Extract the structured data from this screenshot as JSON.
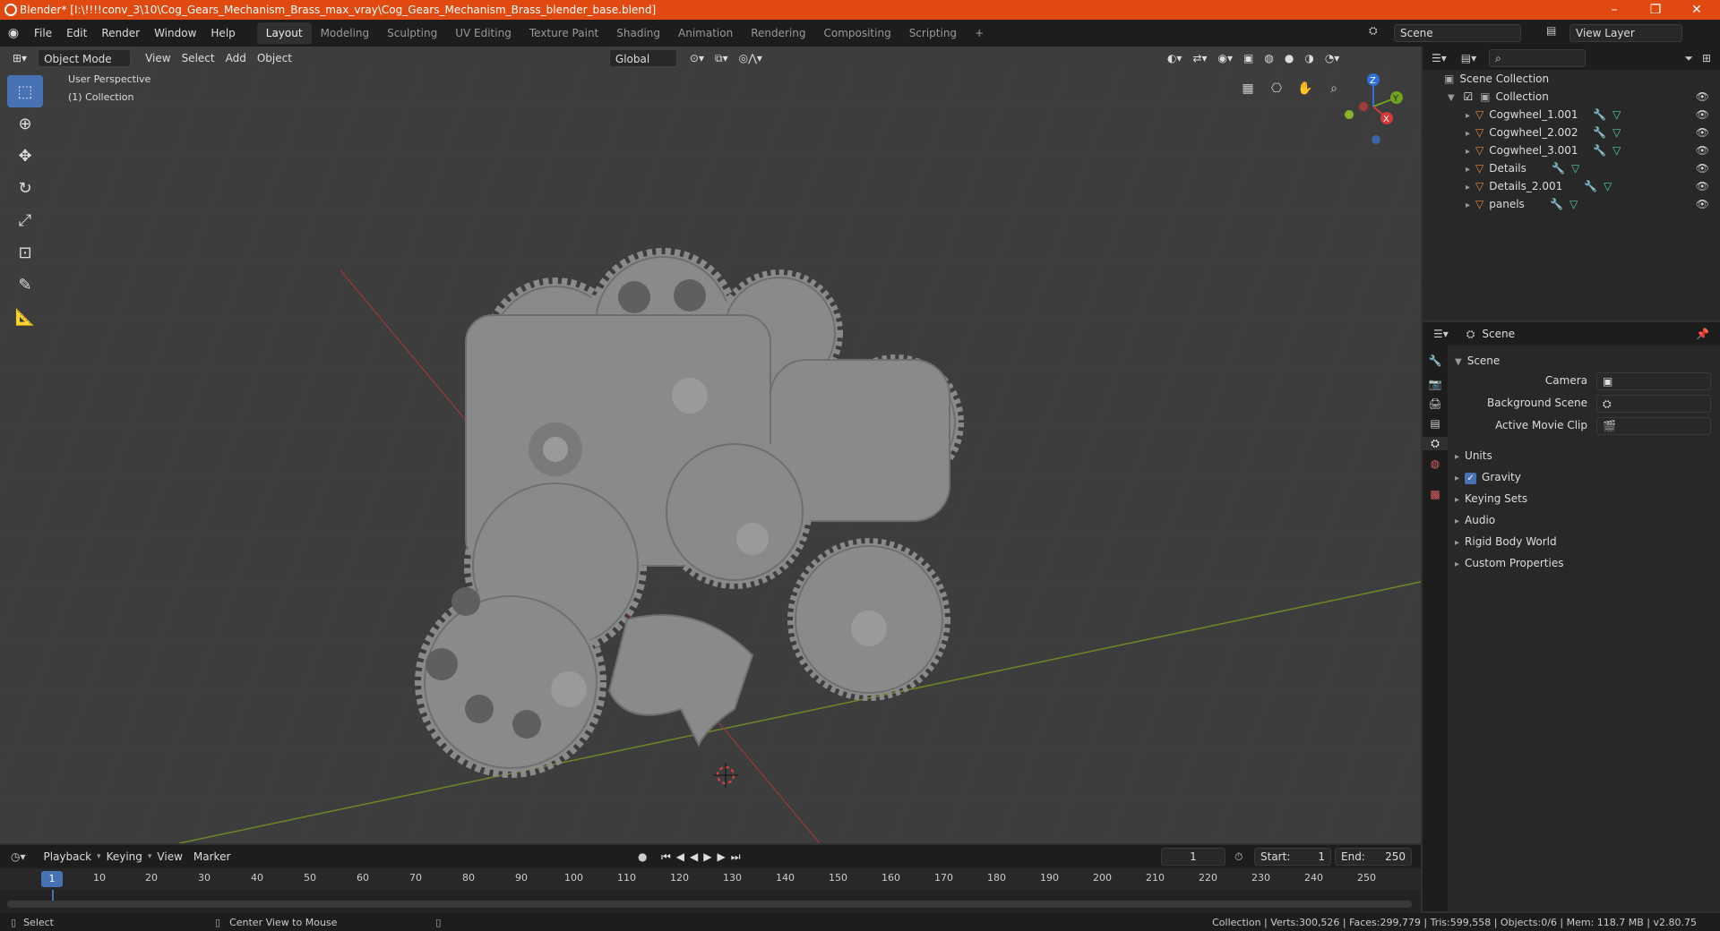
{
  "window": {
    "title": "Blender* [I:\\!!!!conv_3\\10\\Cog_Gears_Mechanism_Brass_max_vray\\Cog_Gears_Mechanism_Brass_blender_base.blend]",
    "min": "–",
    "max": "❐",
    "close": "✕"
  },
  "menus": [
    "File",
    "Edit",
    "Render",
    "Window",
    "Help"
  ],
  "workspaces": [
    "Layout",
    "Modeling",
    "Sculpting",
    "UV Editing",
    "Texture Paint",
    "Shading",
    "Animation",
    "Rendering",
    "Compositing",
    "Scripting"
  ],
  "add_ws": "+",
  "scene_field": "Scene",
  "viewlayer_field": "View Layer",
  "viewport_header": {
    "mode": "Object Mode",
    "menus": [
      "View",
      "Select",
      "Add",
      "Object"
    ],
    "orientation": "Global"
  },
  "viewport_overlay": {
    "perspective": "User Perspective",
    "collection": "(1) Collection"
  },
  "gizmo": {
    "z": "Z",
    "y": "Y",
    "x": "X"
  },
  "outliner": {
    "root": "Scene Collection",
    "collection": "Collection",
    "items": [
      "Cogwheel_1.001",
      "Cogwheel_2.002",
      "Cogwheel_3.001",
      "Details",
      "Details_2.001",
      "panels"
    ]
  },
  "properties": {
    "header": "Scene",
    "section": "Scene",
    "camera_label": "Camera",
    "bgscene_label": "Background Scene",
    "movieclip_label": "Active Movie Clip",
    "panels": [
      "Units",
      "Gravity",
      "Keying Sets",
      "Audio",
      "Rigid Body World",
      "Custom Properties"
    ],
    "gravity_checked": true
  },
  "timeline": {
    "menus": [
      "Playback",
      "Keying",
      "View",
      "Marker"
    ],
    "current_frame": "1",
    "start_label": "Start:",
    "start": "1",
    "end_label": "End:",
    "end": "250",
    "ticks": [
      "1",
      "10",
      "20",
      "30",
      "40",
      "50",
      "60",
      "70",
      "80",
      "90",
      "100",
      "110",
      "120",
      "130",
      "140",
      "150",
      "160",
      "170",
      "180",
      "190",
      "200",
      "210",
      "220",
      "230",
      "240",
      "250"
    ]
  },
  "status": {
    "left": "Select",
    "middle": "Center View to Mouse",
    "right": "Collection | Verts:300,526 | Faces:299,779 | Tris:599,558 | Objects:0/6 | Mem: 118.7 MB | v2.80.75"
  }
}
